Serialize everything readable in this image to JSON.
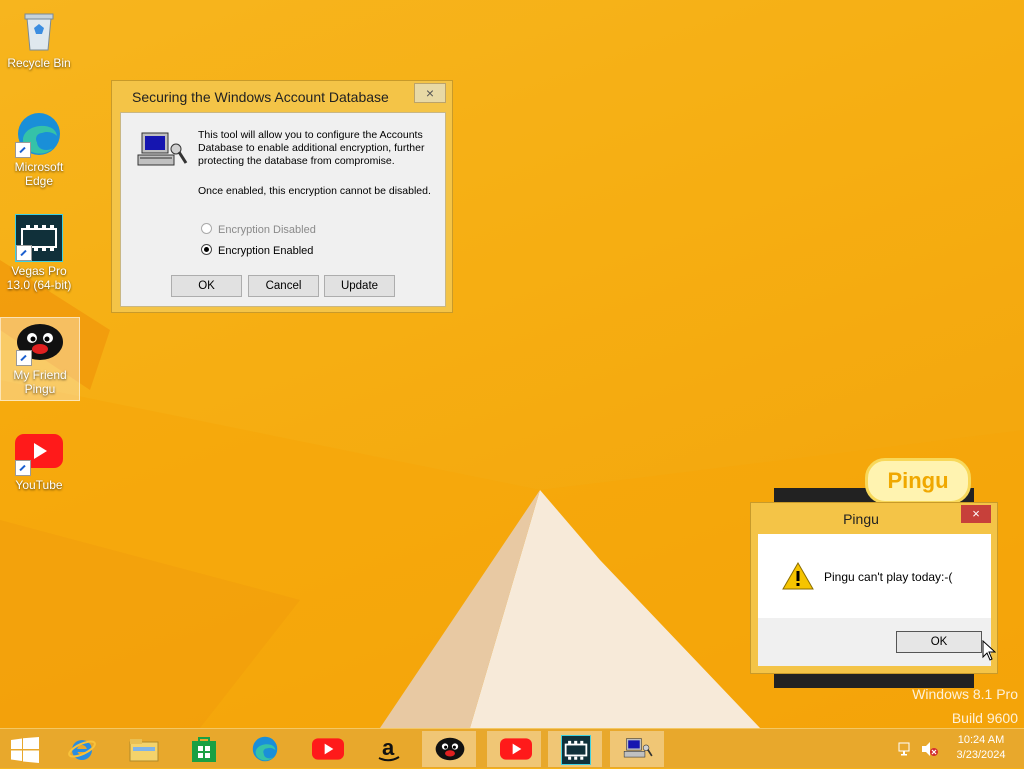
{
  "desktop": {
    "icons": [
      {
        "label": "Recycle Bin"
      },
      {
        "label": "Microsoft Edge"
      },
      {
        "label": "Vegas Pro 13.0 (64-bit)"
      },
      {
        "label": "My Friend Pingu"
      },
      {
        "label": "YouTube"
      }
    ]
  },
  "dialog1": {
    "title": "Securing the Windows Account Database",
    "close_label": "×",
    "description": "This tool will allow you to configure the Accounts Database to enable additional encryption, further protecting the database from compromise.",
    "note": "Once enabled, this encryption cannot be disabled.",
    "option_disabled": "Encryption Disabled",
    "option_enabled": "Encryption Enabled",
    "selected_option": "Encryption Enabled",
    "ok_label": "OK",
    "cancel_label": "Cancel",
    "update_label": "Update"
  },
  "dialog2": {
    "title": "Pingu",
    "close_label": "×",
    "message": "Pingu can't play today:-(",
    "ok_label": "OK"
  },
  "background_app": {
    "logo_text": "Pingu"
  },
  "watermark": {
    "line1": "Windows 8.1 Pro",
    "line2": "Build 9600"
  },
  "taskbar": {
    "items": [
      {
        "name": "start-icon"
      },
      {
        "name": "internet-explorer-icon"
      },
      {
        "name": "file-explorer-icon"
      },
      {
        "name": "store-icon"
      },
      {
        "name": "edge-icon"
      },
      {
        "name": "youtube-icon"
      },
      {
        "name": "amazon-icon"
      },
      {
        "name": "pingu-icon"
      },
      {
        "name": "youtube-icon"
      },
      {
        "name": "vegas-pro-icon"
      },
      {
        "name": "account-database-tool-icon"
      }
    ],
    "clock_time": "10:24 AM",
    "clock_date": "3/23/2024"
  },
  "colors": {
    "accent": "#f4c447",
    "close_red": "#c7403a"
  }
}
